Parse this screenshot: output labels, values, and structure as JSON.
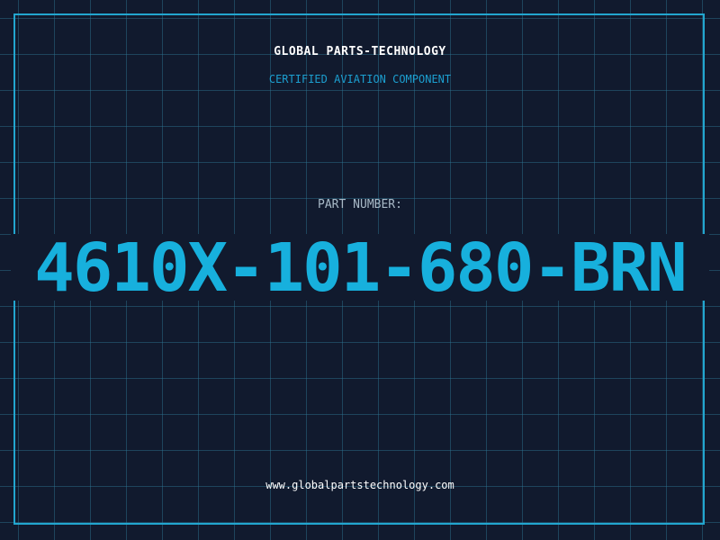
{
  "header": {
    "company": "GLOBAL PARTS-TECHNOLOGY",
    "tagline": "CERTIFIED AVIATION COMPONENT"
  },
  "part": {
    "label": "PART NUMBER:",
    "number": "4610X-101-680-BRN"
  },
  "footer": {
    "website": "www.globalpartstechnology.com"
  },
  "colors": {
    "background": "#111a2e",
    "grid": "#2e7896",
    "frame": "#22a6cf",
    "accent": "#17b0dd",
    "label": "#a9bac8",
    "text": "#ffffff"
  }
}
